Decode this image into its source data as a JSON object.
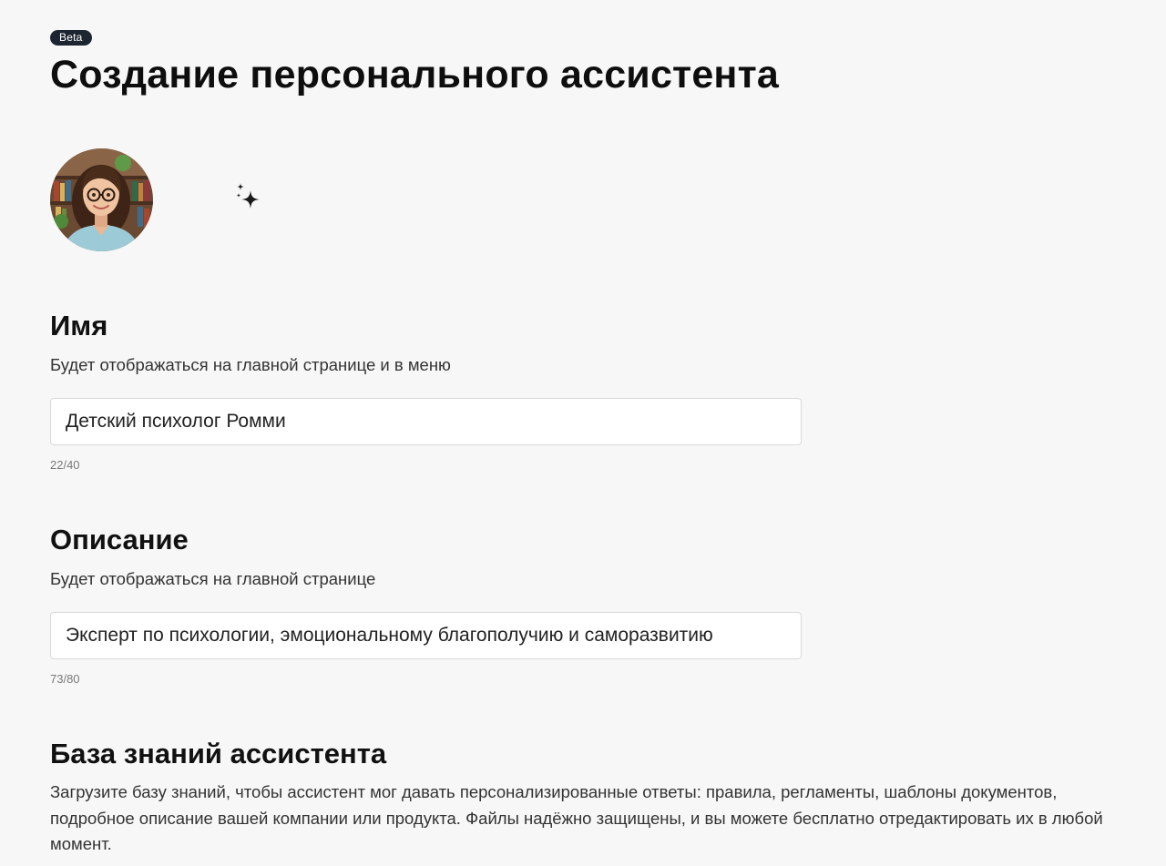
{
  "header": {
    "badge": "Beta",
    "title": "Создание персонального ассистента"
  },
  "avatar": {
    "icon": "avatar-image",
    "generate_icon": "sparkles-icon"
  },
  "name_section": {
    "title": "Имя",
    "hint": "Будет отображаться на главной странице и в меню",
    "value": "Детский психолог Ромми",
    "counter": "22/40"
  },
  "description_section": {
    "title": "Описание",
    "hint": "Будет отображаться на главной странице",
    "value": "Эксперт по психологии, эмоциональному благополучию и саморазвитию",
    "counter": "73/80"
  },
  "knowledge_section": {
    "title": "База знаний ассистента",
    "text": "Загрузите базу знаний, чтобы ассистент мог давать персонализированные ответы: правила, регламенты, шаблоны документов, подробное описание вашей компании или продукта. Файлы надёжно защищены, и вы можете бесплатно отредактировать их в любой момент."
  },
  "colors": {
    "background": "#f7f7f7",
    "badge": "#1d2630",
    "text": "#111111",
    "muted": "#7a7a7a",
    "field_border": "#d9d9d9"
  }
}
